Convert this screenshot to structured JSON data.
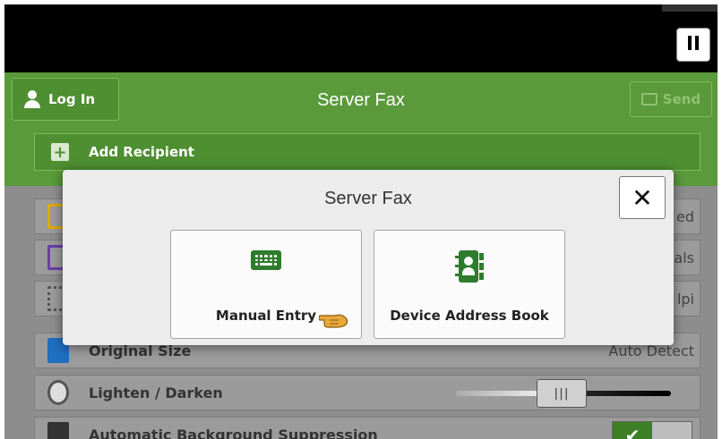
{
  "topbar": {
    "pause_icon": "pause-icon"
  },
  "header": {
    "login_label": "Log In",
    "title": "Server Fax",
    "send_label": "Send",
    "accent": "#5a9a3b"
  },
  "recipient": {
    "add_label": "Add Recipient"
  },
  "list": {
    "rows": [
      {
        "label": "",
        "value": "ed",
        "icon": "document-icon",
        "color": "#e0a800"
      },
      {
        "label": "",
        "value": "als",
        "icon": "screen-icon",
        "color": "#6a3ea8"
      },
      {
        "label": "",
        "value": "lpi",
        "icon": "grid-icon",
        "color": "#555555"
      },
      {
        "label": "Original Size",
        "value": "Auto Detect",
        "icon": "size-icon",
        "color": "#1e6fc0"
      },
      {
        "label": "Lighten / Darken",
        "value": "",
        "icon": "contrast-icon",
        "color": "#555555"
      },
      {
        "label": "Automatic Background Suppression",
        "value": "",
        "icon": "suppression-icon",
        "color": "#333333"
      }
    ],
    "toggle_mark": "✔"
  },
  "dialog": {
    "title": "Server Fax",
    "close_label": "✕",
    "options": [
      {
        "label": "Manual Entry",
        "icon": "keyboard-icon"
      },
      {
        "label": "Device Address Book",
        "icon": "address-book-icon"
      }
    ]
  }
}
